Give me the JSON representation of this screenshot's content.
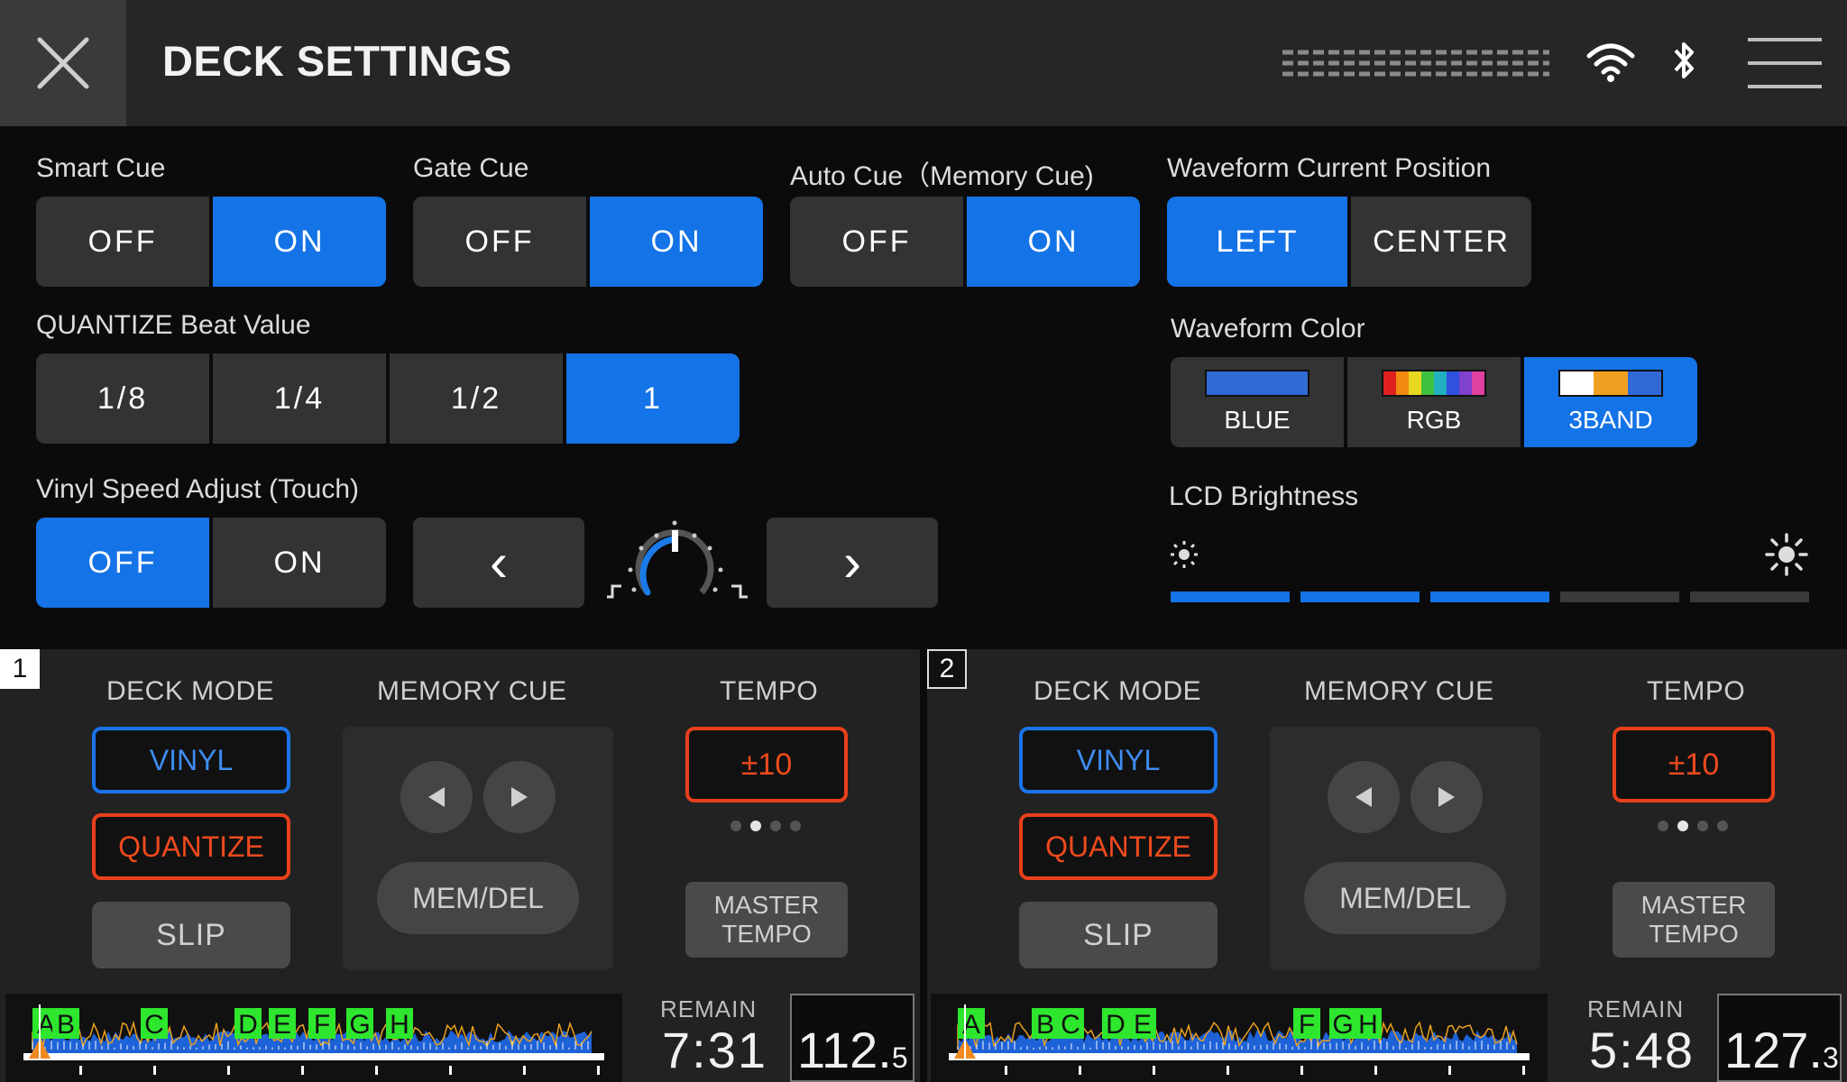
{
  "header": {
    "title": "DECK SETTINGS",
    "close_icon": "close-icon",
    "wifi_icon": "wifi-icon",
    "bluetooth_icon": "bluetooth-icon",
    "menu_icon": "hamburger-menu-icon"
  },
  "settings": {
    "smart_cue": {
      "label": "Smart Cue",
      "options": [
        "OFF",
        "ON"
      ],
      "selected": "ON"
    },
    "gate_cue": {
      "label": "Gate Cue",
      "options": [
        "OFF",
        "ON"
      ],
      "selected": "ON"
    },
    "auto_cue": {
      "label": "Auto Cue（Memory Cue)",
      "options": [
        "OFF",
        "ON"
      ],
      "selected": "ON"
    },
    "waveform_position": {
      "label": "Waveform Current Position",
      "options": [
        "LEFT",
        "CENTER"
      ],
      "selected": "LEFT"
    },
    "quantize": {
      "label": "QUANTIZE Beat Value",
      "options": [
        "1/8",
        "1/4",
        "1/2",
        "1"
      ],
      "selected": "1"
    },
    "waveform_color": {
      "label": "Waveform Color",
      "options": [
        "BLUE",
        "RGB",
        "3BAND"
      ],
      "selected": "3BAND"
    },
    "vinyl_speed": {
      "label": "Vinyl Speed Adjust (Touch)",
      "options": [
        "OFF",
        "ON"
      ],
      "selected": "OFF",
      "prev_glyph": "‹",
      "next_glyph": "›",
      "knob_icon": "speed-knob-icon"
    },
    "lcd_brightness": {
      "label": "LCD Brightness",
      "level": 3,
      "max": 5,
      "low_icon": "brightness-low-icon",
      "high_icon": "brightness-high-icon"
    }
  },
  "colors": {
    "accent": "#1473e6",
    "tempo_red": "#e8401c",
    "vinyl_blue": "#1a73e8"
  },
  "decks": [
    {
      "number": "1",
      "deck_mode_label": "DECK MODE",
      "memory_cue_label": "MEMORY CUE",
      "tempo_label": "TEMPO",
      "vinyl": "VINYL",
      "quantize": "QUANTIZE",
      "slip": "SLIP",
      "memdel": "MEM/DEL",
      "tempo_range": "±10",
      "tempo_dot_selected": 2,
      "master_line1": "MASTER",
      "master_line2": "TEMPO",
      "remain_label": "REMAIN",
      "remain": "7:31",
      "bpm_main": "112.",
      "bpm_decimal": "5",
      "cue_markers": [
        "A",
        "B",
        "C",
        "D",
        "E",
        "F",
        "G",
        "H"
      ]
    },
    {
      "number": "2",
      "deck_mode_label": "DECK MODE",
      "memory_cue_label": "MEMORY CUE",
      "tempo_label": "TEMPO",
      "vinyl": "VINYL",
      "quantize": "QUANTIZE",
      "slip": "SLIP",
      "memdel": "MEM/DEL",
      "tempo_range": "±10",
      "tempo_dot_selected": 2,
      "master_line1": "MASTER",
      "master_line2": "TEMPO",
      "remain_label": "REMAIN",
      "remain": "5:48",
      "bpm_main": "127.",
      "bpm_decimal": "3",
      "cue_markers": [
        "A",
        "B",
        "C",
        "D",
        "E",
        "F",
        "G",
        "H"
      ]
    }
  ]
}
